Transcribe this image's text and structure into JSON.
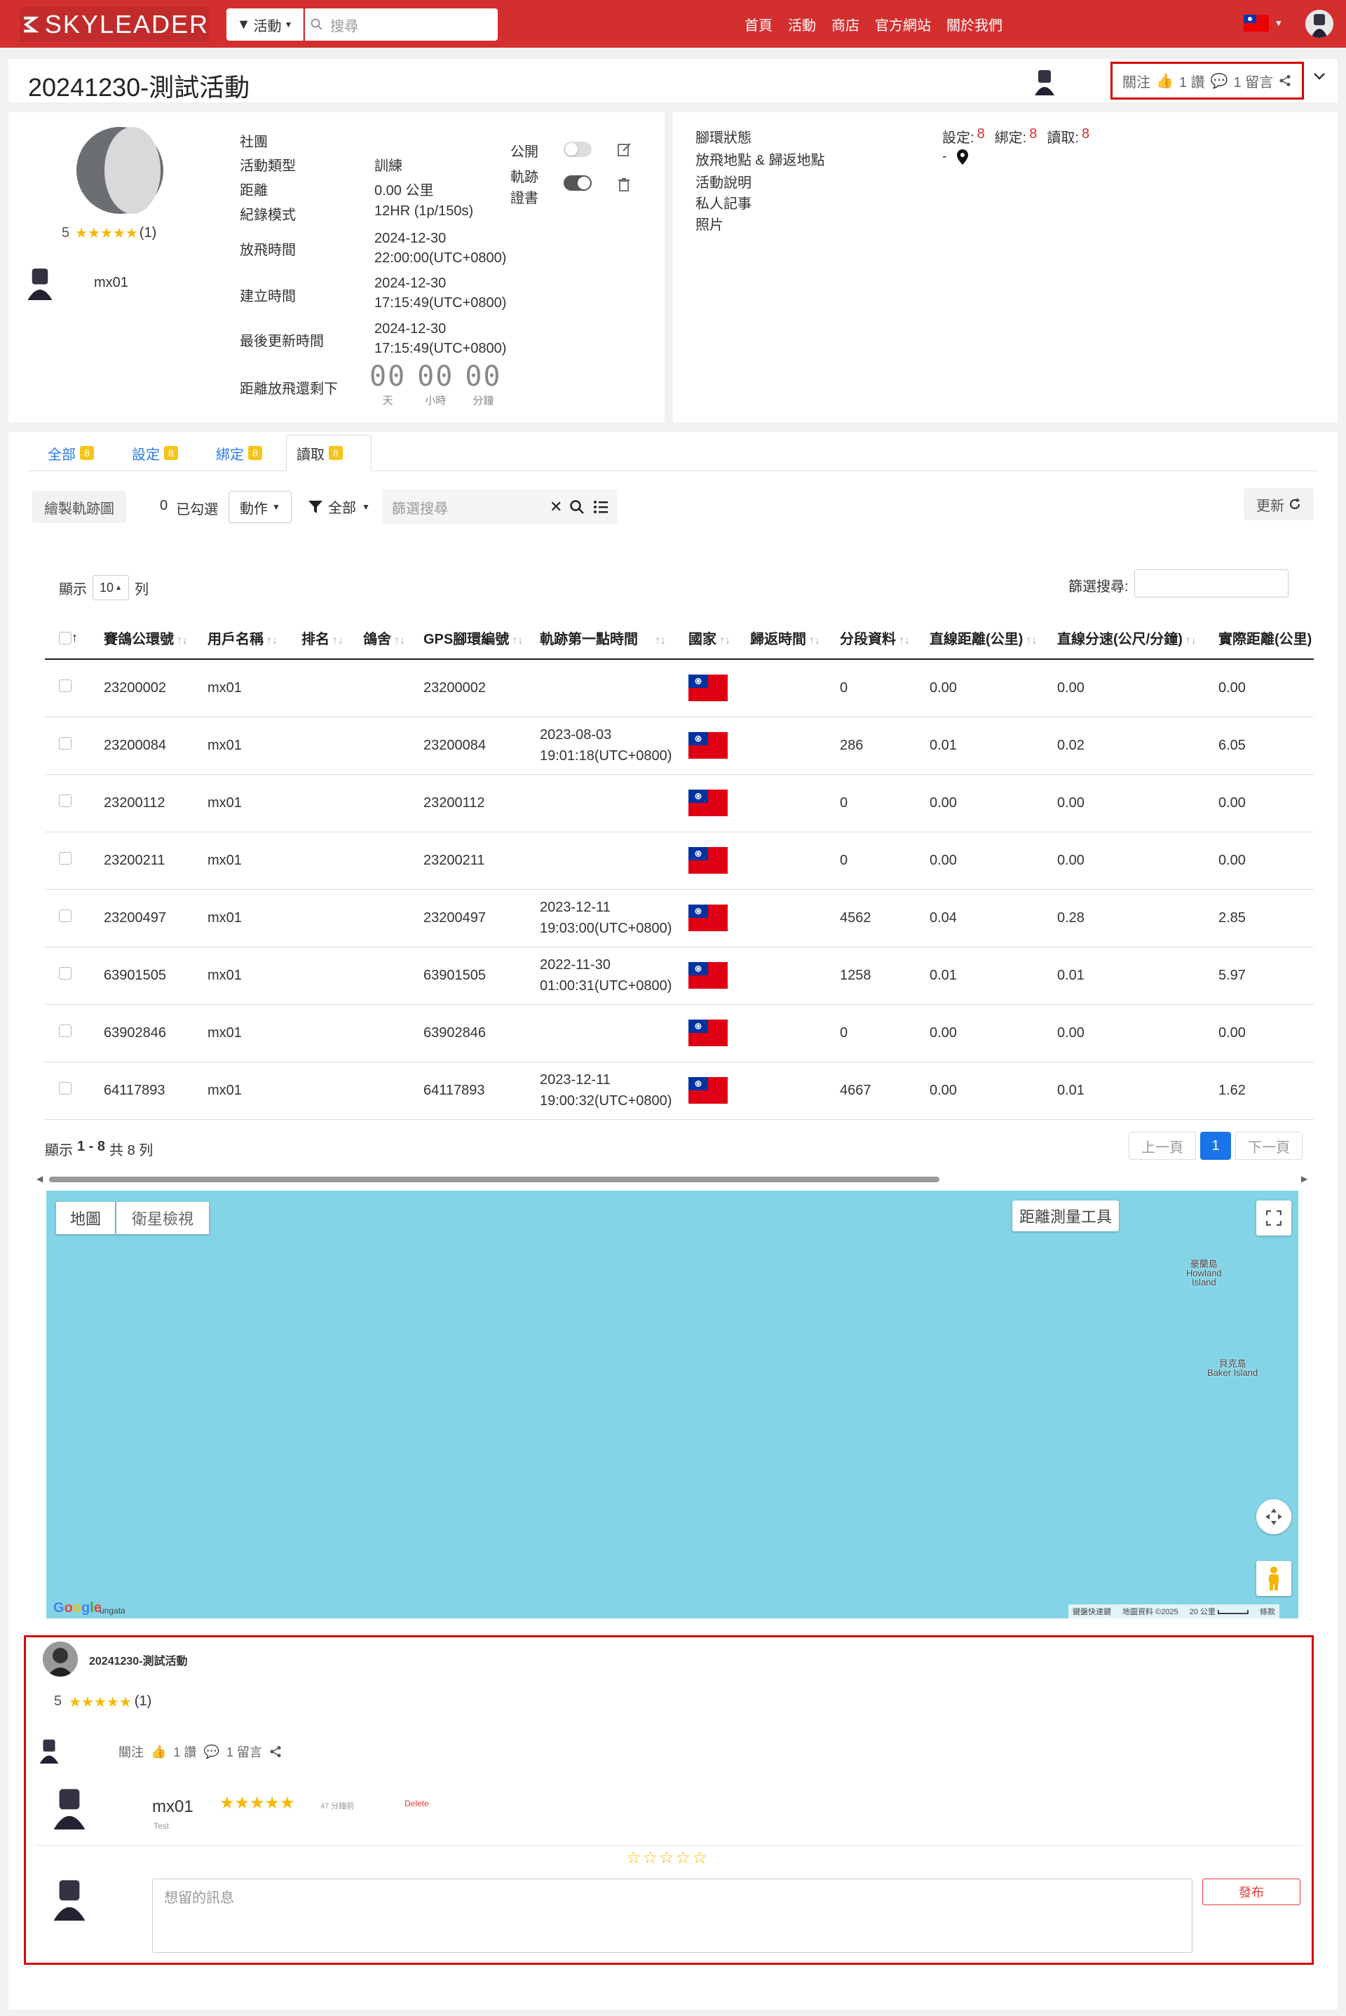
{
  "nav": {
    "logo": "SKYLEADER",
    "filter_label": "活動",
    "search_placeholder": "搜尋",
    "links": [
      "首頁",
      "活動",
      "商店",
      "官方網站",
      "關於我們"
    ]
  },
  "title": {
    "text": "20241230-測試活動",
    "follow": "關注",
    "likes": "1 讚",
    "comments": "1 留言"
  },
  "info": {
    "rating_value": "5",
    "rating_count": "(1)",
    "owner": "mx01",
    "labels": {
      "club": "社團",
      "type": "活動類型",
      "distance": "距離",
      "record_mode": "紀錄模式",
      "release_time": "放飛時間",
      "created": "建立時間",
      "updated": "最後更新時間",
      "countdown": "距離放飛還剩下",
      "public": "公開",
      "track_line1": "軌跡",
      "track_line2": "證書"
    },
    "values": {
      "type": "訓練",
      "distance": "0.00 公里",
      "record_mode": "12HR (1p/150s)",
      "release_date": "2024-12-30",
      "release_time": "22:00:00(UTC+0800)",
      "created_date": "2024-12-30",
      "created_time": "17:15:49(UTC+0800)",
      "updated_date": "2024-12-30",
      "updated_time": "17:15:49(UTC+0800)"
    },
    "countdown": {
      "days": "00",
      "hours": "00",
      "minutes": "00",
      "days_label": "天",
      "hours_label": "小時",
      "minutes_label": "分鐘"
    }
  },
  "right_panel": {
    "labels": [
      "腳環狀態",
      "放飛地點 & 歸返地點",
      "活動說明",
      "私人記事",
      "照片"
    ],
    "set_label": "設定:",
    "set_value": "8",
    "bind_label": "綁定:",
    "bind_value": "8",
    "read_label": "讀取:",
    "read_value": "8",
    "location_value": "-"
  },
  "tabs": [
    {
      "label": "全部",
      "count": "8"
    },
    {
      "label": "設定",
      "count": "8"
    },
    {
      "label": "綁定",
      "count": "8"
    },
    {
      "label": "讀取",
      "count": "8"
    }
  ],
  "toolbar": {
    "draw_track": "繪製軌跡圖",
    "selected_count": "0",
    "selected_label": "已勾選",
    "action": "動作",
    "filter_all": "全部",
    "filter_placeholder": "篩選搜尋",
    "refresh": "更新"
  },
  "table_controls": {
    "show": "顯示",
    "page_size": "10",
    "rows": "列",
    "search_label": "篩選搜尋:"
  },
  "table": {
    "headers": [
      "賽鴿公環號",
      "用戶名稱",
      "排名",
      "鴿舍",
      "GPS腳環編號",
      "軌跡第一點時間",
      "國家",
      "歸返時間",
      "分段資料",
      "直線距離(公里)",
      "直線分速(公尺/分鐘)",
      "實際距離(公里)"
    ],
    "rows": [
      {
        "ring": "23200002",
        "user": "mx01",
        "gps": "23200002",
        "t1": "",
        "t2": "",
        "seg": "0",
        "dist": "0.00",
        "speed": "0.00",
        "real": "0.00"
      },
      {
        "ring": "23200084",
        "user": "mx01",
        "gps": "23200084",
        "t1": "2023-08-03",
        "t2": "19:01:18(UTC+0800)",
        "seg": "286",
        "dist": "0.01",
        "speed": "0.02",
        "real": "6.05"
      },
      {
        "ring": "23200112",
        "user": "mx01",
        "gps": "23200112",
        "t1": "",
        "t2": "",
        "seg": "0",
        "dist": "0.00",
        "speed": "0.00",
        "real": "0.00"
      },
      {
        "ring": "23200211",
        "user": "mx01",
        "gps": "23200211",
        "t1": "",
        "t2": "",
        "seg": "0",
        "dist": "0.00",
        "speed": "0.00",
        "real": "0.00"
      },
      {
        "ring": "23200497",
        "user": "mx01",
        "gps": "23200497",
        "t1": "2023-12-11",
        "t2": "19:03:00(UTC+0800)",
        "seg": "4562",
        "dist": "0.04",
        "speed": "0.28",
        "real": "2.85"
      },
      {
        "ring": "63901505",
        "user": "mx01",
        "gps": "63901505",
        "t1": "2022-11-30",
        "t2": "01:00:31(UTC+0800)",
        "seg": "1258",
        "dist": "0.01",
        "speed": "0.01",
        "real": "5.97"
      },
      {
        "ring": "63902846",
        "user": "mx01",
        "gps": "63902846",
        "t1": "",
        "t2": "",
        "seg": "0",
        "dist": "0.00",
        "speed": "0.00",
        "real": "0.00"
      },
      {
        "ring": "64117893",
        "user": "mx01",
        "gps": "64117893",
        "t1": "2023-12-11",
        "t2": "19:00:32(UTC+0800)",
        "seg": "4667",
        "dist": "0.00",
        "speed": "0.01",
        "real": "1.62"
      }
    ]
  },
  "pagination": {
    "summary_prefix": "顯示",
    "summary_range": "1 - 8",
    "summary_total": "共 8 列",
    "prev": "上一頁",
    "page": "1",
    "next": "下一頁"
  },
  "map": {
    "tab_map": "地圖",
    "tab_satellite": "衛星檢視",
    "measure": "距離測量工具",
    "label1_zh": "豪蘭島",
    "label1_en": "Howland",
    "label1_en2": "Island",
    "label2_zh": "貝克島",
    "label2_en": "Baker Island",
    "google": "Google",
    "footer_left": "ungata",
    "footer_shortcuts": "鍵盤快速鍵",
    "footer_data": "地圖資料 ©2025",
    "footer_scale": "20 公里",
    "footer_terms": "條款"
  },
  "comments": {
    "title": "20241230-測試活動",
    "rating_value": "5",
    "rating_count": "(1)",
    "follow": "關注",
    "likes": "1 讚",
    "comment_count": "1 留言",
    "entry_user": "mx01",
    "entry_time": "47 分鐘前",
    "entry_delete": "Delete",
    "entry_text": "Test",
    "input_placeholder": "想留的訊息",
    "submit": "發布"
  },
  "colors": {
    "brand": "#d32f2f",
    "accent": "#2a7ae2",
    "badge": "#f5c518",
    "map_water": "#84d4e8"
  }
}
